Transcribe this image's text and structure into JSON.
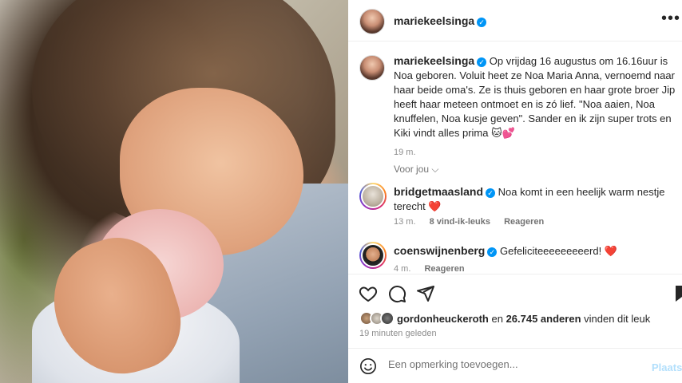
{
  "post": {
    "username": "mariekeelsinga",
    "verified_icon": "verified-badge-icon",
    "more_label": "•••"
  },
  "caption": {
    "username": "mariekeelsinga",
    "text": "Op vrijdag 16 augustus om 16.16uur is Noa geboren. Voluit heet ze Noa Maria Anna, vernoemd naar haar beide oma's. Ze is thuis geboren en haar grote broer Jip heeft haar meteen ontmoet en is zó lief. \"Noa aaien, Noa knuffelen, Noa kusje geven\". Sander en ik zijn super trots en Kiki vindt alles prima 🐱💕",
    "time": "19 m."
  },
  "for_you_label": "Voor jou ⌵",
  "comments": [
    {
      "username": "bridgetmaasland",
      "text": "Noa komt in een heelijk warm nestje terecht ❤️",
      "time": "13 m.",
      "likes": "8 vind-ik-leuks",
      "reply": "Reageren"
    },
    {
      "username": "coenswijnenberg",
      "text": "Gefeliciteeeeeeeeerd! ❤️",
      "time": "4 m.",
      "reply": "Reageren"
    }
  ],
  "likes": {
    "first_user": "gordonheuckeroth",
    "conjunction": "en",
    "count": "26.745 anderen",
    "suffix": "vinden dit leuk"
  },
  "posted_ago": "19 minuten geleden",
  "add_comment": {
    "placeholder": "Een opmerking toevoegen...",
    "post_label": "Plaatsen"
  },
  "colors": {
    "verified": "#0095f6",
    "heart": "#ed4956",
    "post_disabled": "#b2dffc"
  }
}
